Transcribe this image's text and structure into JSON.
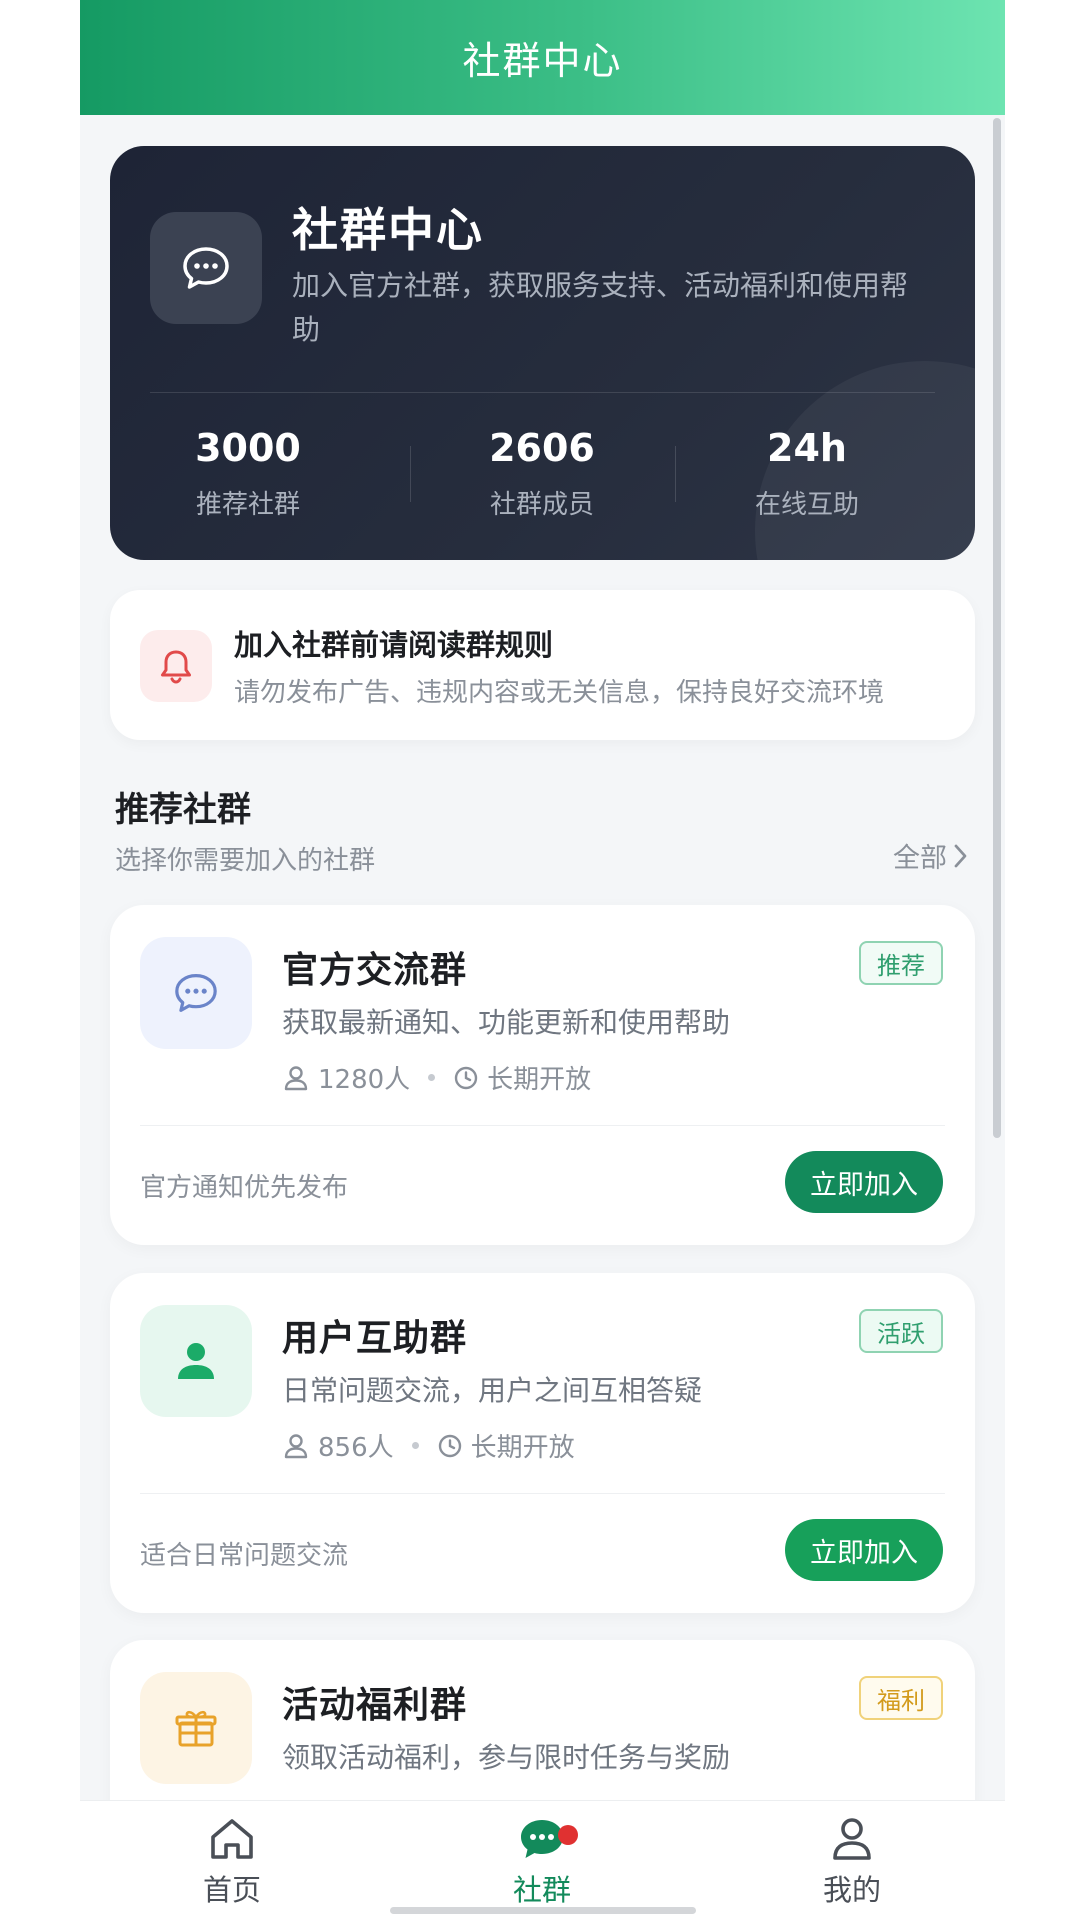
{
  "header": {
    "title": "社群中心"
  },
  "hero": {
    "title": "社群中心",
    "description": "加入官方社群，获取服务支持、活动福利和使用帮助",
    "stats": [
      {
        "value": "3000",
        "label": "推荐社群"
      },
      {
        "value": "2606",
        "label": "社群成员"
      },
      {
        "value": "24h",
        "label": "在线互助"
      }
    ]
  },
  "notice": {
    "title": "加入社群前请阅读群规则",
    "text": "请勿发布广告、违规内容或无关信息，保持良好交流环境"
  },
  "section": {
    "title": "推荐社群",
    "subtitle": "选择你需要加入的社群",
    "all_label": "全部"
  },
  "groups": [
    {
      "name": "官方交流群",
      "description": "获取最新通知、功能更新和使用帮助",
      "members": "1280人",
      "status": "长期开放",
      "badge": "推荐",
      "note": "官方通知优先发布",
      "button": "立即加入",
      "icon": "chat-bubble-icon",
      "colors": {
        "icon_bg": "#eef2fd",
        "icon": "#6a84c9",
        "badge_fg": "#2f9e6e",
        "badge_border": "#8fd3b2",
        "badge_bg": "#f1fbf6",
        "button": "#138a5b"
      }
    },
    {
      "name": "用户互助群",
      "description": "日常问题交流，用户之间互相答疑",
      "members": "856人",
      "status": "长期开放",
      "badge": "活跃",
      "note": "适合日常问题交流",
      "button": "立即加入",
      "icon": "user-icon",
      "colors": {
        "icon_bg": "#e6f7ef",
        "icon": "#1bab68",
        "badge_fg": "#2f9e6e",
        "badge_border": "#8fd3b2",
        "badge_bg": "#ecfaf3",
        "button": "#17a05a"
      }
    },
    {
      "name": "活动福利群",
      "description": "领取活动福利，参与限时任务与奖励",
      "badge": "福利",
      "icon": "gift-icon",
      "colors": {
        "icon_bg": "#fdf4e4",
        "icon": "#e8a22a",
        "badge_fg": "#d39b1c",
        "badge_border": "#f0d27a",
        "badge_bg": "#fffbee"
      }
    }
  ],
  "tabs": [
    {
      "label": "首页",
      "icon": "home-icon",
      "active": false
    },
    {
      "label": "社群",
      "icon": "chat-icon",
      "active": true
    },
    {
      "label": "我的",
      "icon": "profile-icon",
      "active": false
    }
  ],
  "colors": {
    "accent": "#138a5b",
    "header_start": "#159a63",
    "header_end": "#6de4b1",
    "hero_bg": "#1e2436",
    "unread_dot": "#e03131"
  }
}
